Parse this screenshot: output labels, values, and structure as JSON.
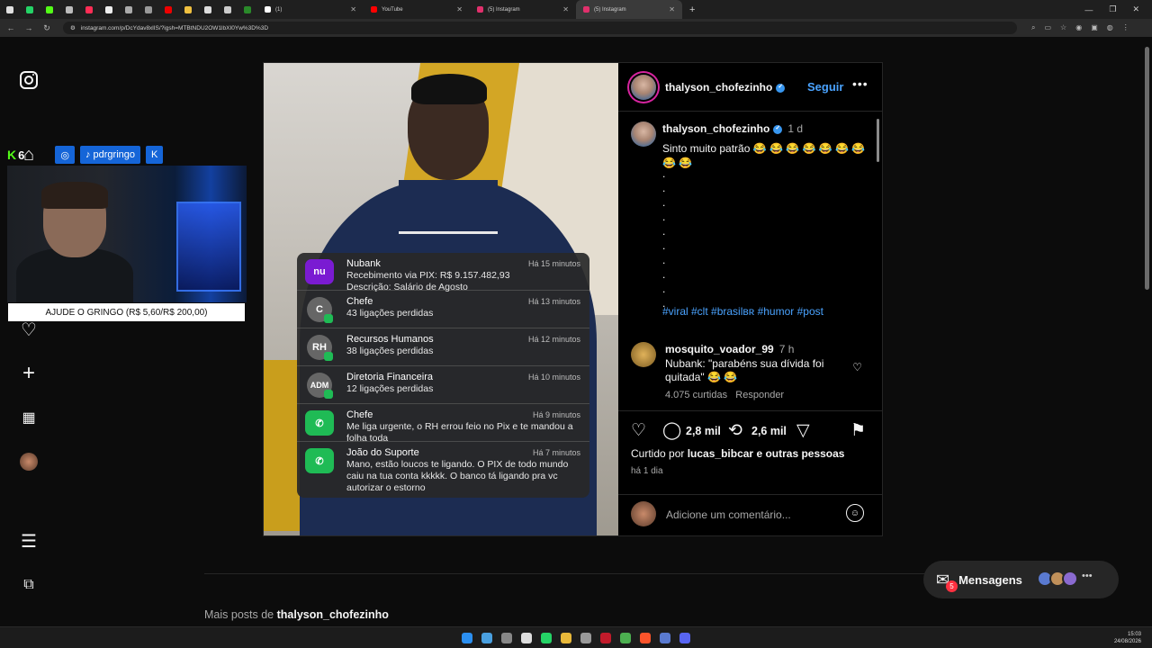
{
  "browser": {
    "tabs": [
      {
        "label": "(1)",
        "color": "#ffffff"
      },
      {
        "label": "YouTube",
        "color": "#ff0000"
      },
      {
        "label": "(5) Instagram",
        "color": "#e1306c"
      },
      {
        "label": "(5) Instagram",
        "color": "#e1306c"
      }
    ],
    "url": "instagram.com/p/DcYdav8xlIS/?igsh=MTBtNDU2OW1lbXI0Yw%3D%3D"
  },
  "stream": {
    "kick_count": "6",
    "tiktok_handle": "pdrgringo",
    "donate": "AJUDE O GRINGO (R$ 5,60/R$ 200,00)"
  },
  "media": {
    "notifications": [
      {
        "app": "nubank",
        "title": "Nubank",
        "time": "Há 15 minutos",
        "body": "Recebimento via PIX: R$ 9.157.482,93\nDescrição: Salário de Agosto",
        "icon": "nu"
      },
      {
        "app": "contact",
        "title": "Chefe",
        "time": "Há 13 minutos",
        "body": "43 ligações perdidas",
        "icon": "C"
      },
      {
        "app": "contact",
        "title": "Recursos Humanos",
        "time": "Há 12 minutos",
        "body": "38 ligações perdidas",
        "icon": "RH"
      },
      {
        "app": "contact",
        "title": "Diretoria Financeira",
        "time": "Há 10 minutos",
        "body": "12 ligações perdidas",
        "icon": "ADM"
      },
      {
        "app": "whatsapp",
        "title": "Chefe",
        "time": "Há 9 minutos",
        "body": "Me liga urgente, o RH errou feio no Pix e te mandou a folha toda",
        "icon": "wa"
      },
      {
        "app": "whatsapp",
        "title": "João do Suporte",
        "time": "Há 7 minutos",
        "body": "Mano, estão loucos te ligando. O PIX de todo mundo caiu na tua conta kkkkk. O banco tá ligando pra vc autorizar o estorno",
        "icon": "wa"
      }
    ]
  },
  "post": {
    "author": "thalyson_chofezinho",
    "follow_label": "Seguir",
    "more_label": "•••",
    "caption_time": "1 d",
    "caption": "Sinto muito patrão 😂 😂 😂 😂 😂 😂 😂 😂 😂",
    "dots": ".\n.\n.\n.\n.\n.\n.\n.\n.\n.",
    "hashtags": "#viral #clt #brasilʙʀ #humor #post",
    "comment": {
      "user": "mosquito_voador_99",
      "time": "7 h",
      "text": "Nubank: \"parabéns sua dívida foi quitada\" 😂 😂",
      "likes": "4.075 curtidas",
      "reply": "Responder"
    },
    "comments_count": "2,8 mil",
    "reposts_count": "2,6 mil",
    "liked_by_prefix": "Curtido por",
    "liked_by_user": "lucas_bibcar",
    "liked_by_suffix": "e outras pessoas",
    "posted_ago": "há 1 dia",
    "add_comment_placeholder": "Adicione um comentário..."
  },
  "footer": {
    "more_posts_prefix": "Mais posts de",
    "more_posts_user": "thalyson_chofezinho"
  },
  "messages": {
    "label": "Mensagens",
    "badge": "5"
  },
  "taskbar": {
    "time": "15:03",
    "date": "24/08/2026"
  }
}
